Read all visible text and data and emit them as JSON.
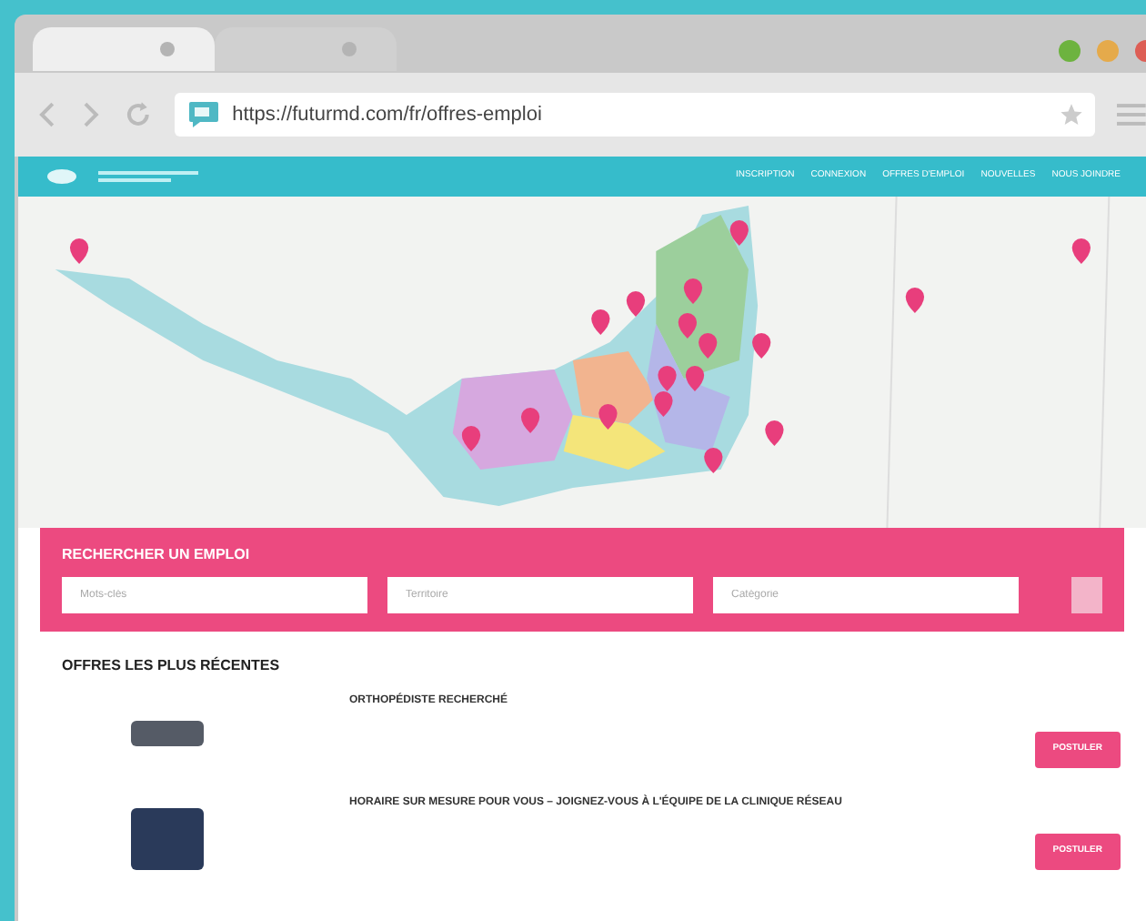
{
  "browser": {
    "tabs": [
      {
        "selected": true
      },
      {
        "selected": false
      }
    ],
    "url": "https://futurmd.com/fr/offres-emploi"
  },
  "nav": {
    "items": [
      "INSCRIPTION",
      "CONNEXION",
      "OFFRES D'EMPLOI",
      "NOUVELLES",
      "NOUS JOINDRE"
    ]
  },
  "search": {
    "title": "RECHERCHER UN EMPLOI",
    "fields": [
      {
        "placeholder": "Mots-clés"
      },
      {
        "placeholder": "Territoire"
      },
      {
        "placeholder": "Catégorie"
      }
    ]
  },
  "recent": {
    "title": "OFFRES LES PLUS RÉCENTES",
    "jobs": [
      {
        "title": "ORTHOPÉDISTE RECHERCHÉ",
        "button": "POSTULER"
      },
      {
        "title": "HORAIRE SUR MESURE POUR VOUS – JOIGNEZ-VOUS À L'ÉQUIPE DE LA CLINIQUE RÉSEAU",
        "button": "POSTULER"
      }
    ]
  }
}
